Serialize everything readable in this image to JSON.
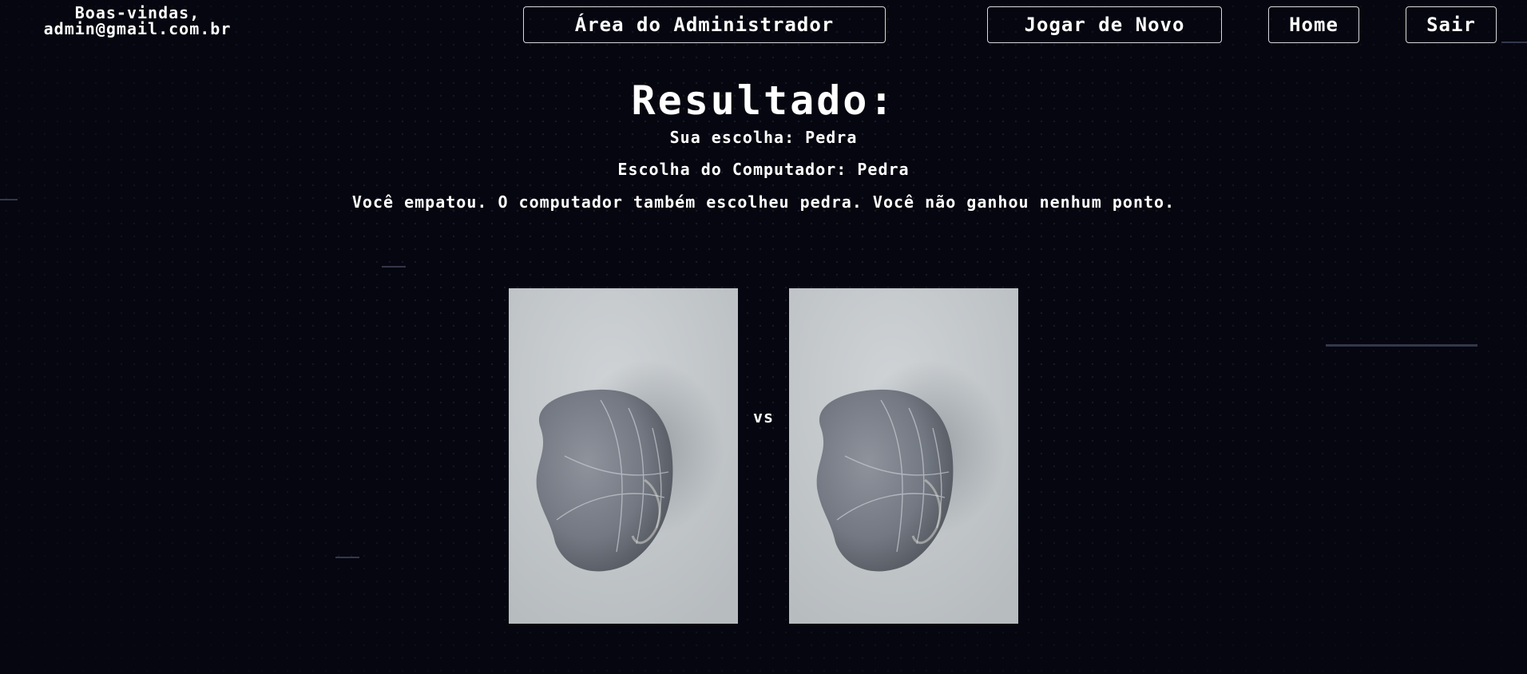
{
  "header": {
    "welcome_line1": "Boas-vindas,",
    "welcome_line2": "admin@gmail.com.br",
    "nav": {
      "admin_label": "Área do Administrador",
      "play_again_label": "Jogar de Novo",
      "home_label": "Home",
      "exit_label": "Sair"
    }
  },
  "result": {
    "title": "Resultado:",
    "your_choice": "Sua escolha: Pedra",
    "computer_choice": "Escolha do Computador: Pedra",
    "message": "Você empatou. O computador também escolheu pedra. Você não ganhou nenhum ponto.",
    "vs_label": "vs",
    "player_image": "stone-photo",
    "computer_image": "stone-photo"
  },
  "colors": {
    "background": "#05060f",
    "text": "#ffffff",
    "button_border": "#d8d8e0"
  }
}
